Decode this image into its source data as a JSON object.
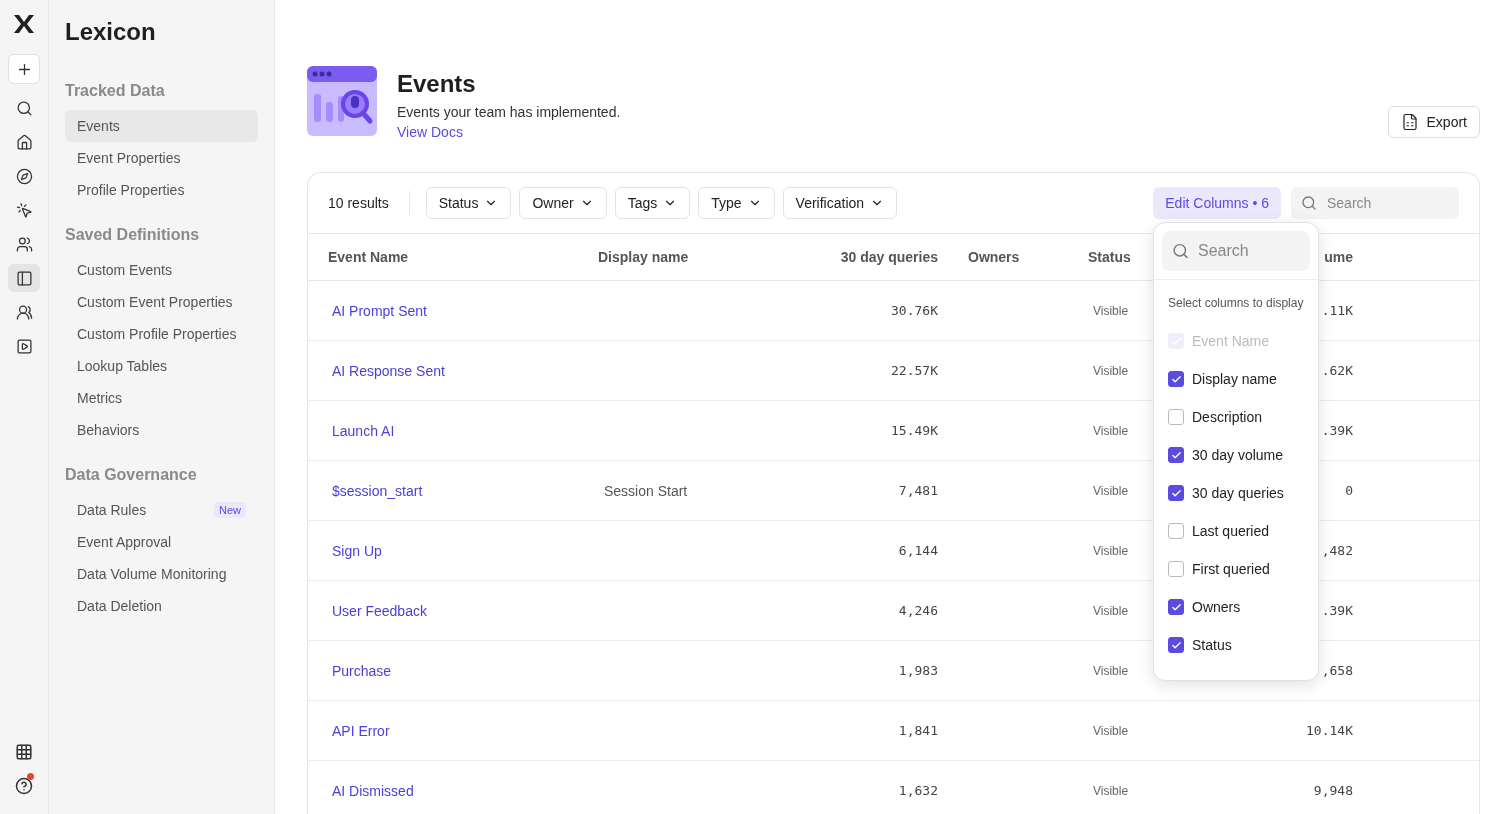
{
  "rail": {
    "items": [
      {
        "kind": "plus",
        "selected": false
      },
      {
        "kind": "search",
        "selected": false
      },
      {
        "kind": "home",
        "selected": false
      },
      {
        "kind": "compass",
        "selected": false
      },
      {
        "kind": "pointer",
        "selected": false
      },
      {
        "kind": "users",
        "selected": false
      },
      {
        "kind": "panel",
        "selected": true
      },
      {
        "kind": "team",
        "selected": false
      },
      {
        "kind": "play",
        "selected": false
      }
    ]
  },
  "sidebar": {
    "title": "Lexicon",
    "sections": [
      {
        "heading": "Tracked Data",
        "items": [
          {
            "label": "Events",
            "selected": true
          },
          {
            "label": "Event Properties",
            "selected": false
          },
          {
            "label": "Profile Properties",
            "selected": false
          }
        ]
      },
      {
        "heading": "Saved Definitions",
        "items": [
          {
            "label": "Custom Events",
            "selected": false
          },
          {
            "label": "Custom Event Properties",
            "selected": false
          },
          {
            "label": "Custom Profile Properties",
            "selected": false
          },
          {
            "label": "Lookup Tables",
            "selected": false
          },
          {
            "label": "Metrics",
            "selected": false
          },
          {
            "label": "Behaviors",
            "selected": false
          }
        ]
      },
      {
        "heading": "Data Governance",
        "items": [
          {
            "label": "Data Rules",
            "selected": false,
            "badge": "New"
          },
          {
            "label": "Event Approval",
            "selected": false
          },
          {
            "label": "Data Volume Monitoring",
            "selected": false
          },
          {
            "label": "Data Deletion",
            "selected": false
          }
        ]
      }
    ]
  },
  "header": {
    "title": "Events",
    "subtitle": "Events your team has implemented.",
    "link": "View Docs",
    "export": "Export"
  },
  "toolbar": {
    "count": "10 results",
    "filters": [
      "Status",
      "Owner",
      "Tags",
      "Type",
      "Verification"
    ],
    "edit_columns": "Edit Columns • 6",
    "search_placeholder": "Search"
  },
  "table": {
    "columns": [
      "Event Name",
      "Display name",
      "30 day queries",
      "Owners",
      "Status",
      "ume"
    ],
    "rows": [
      {
        "event_name": "AI Prompt Sent",
        "queries": "30.76K",
        "status": "Visible",
        "column_6": ".11K"
      },
      {
        "event_name": "AI Response Sent",
        "queries": "22.57K",
        "status": "Visible",
        "column_6": ".62K"
      },
      {
        "event_name": "Launch AI",
        "queries": "15.49K",
        "status": "Visible",
        "column_6": ".39K"
      },
      {
        "event_name": "$session_start",
        "display_name": "Session Start",
        "queries": "7,481",
        "status": "Visible",
        "column_6": "0"
      },
      {
        "event_name": "Sign Up",
        "queries": "6,144",
        "status": "Visible",
        "column_6": ",482"
      },
      {
        "event_name": "User Feedback",
        "queries": "4,246",
        "status": "Visible",
        "column_6": ".39K"
      },
      {
        "event_name": "Purchase",
        "queries": "1,983",
        "status": "Visible",
        "column_6": ",658"
      },
      {
        "event_name": "API Error",
        "queries": "1,841",
        "status": "Visible",
        "column_6": "10.14K"
      },
      {
        "event_name": "AI Dismissed",
        "queries": "1,632",
        "status": "Visible",
        "column_6": "9,948"
      }
    ]
  },
  "column_picker": {
    "search_placeholder": "Search",
    "heading": "Select columns to display",
    "options": [
      {
        "label": "Event Name",
        "checked": true,
        "disabled": true
      },
      {
        "label": "Display name",
        "checked": true,
        "disabled": false
      },
      {
        "label": "Description",
        "checked": false,
        "disabled": false
      },
      {
        "label": "30 day volume",
        "checked": true,
        "disabled": false
      },
      {
        "label": "30 day queries",
        "checked": true,
        "disabled": false
      },
      {
        "label": "Last queried",
        "checked": false,
        "disabled": false
      },
      {
        "label": "First queried",
        "checked": false,
        "disabled": false
      },
      {
        "label": "Owners",
        "checked": true,
        "disabled": false
      },
      {
        "label": "Status",
        "checked": true,
        "disabled": false
      }
    ]
  }
}
